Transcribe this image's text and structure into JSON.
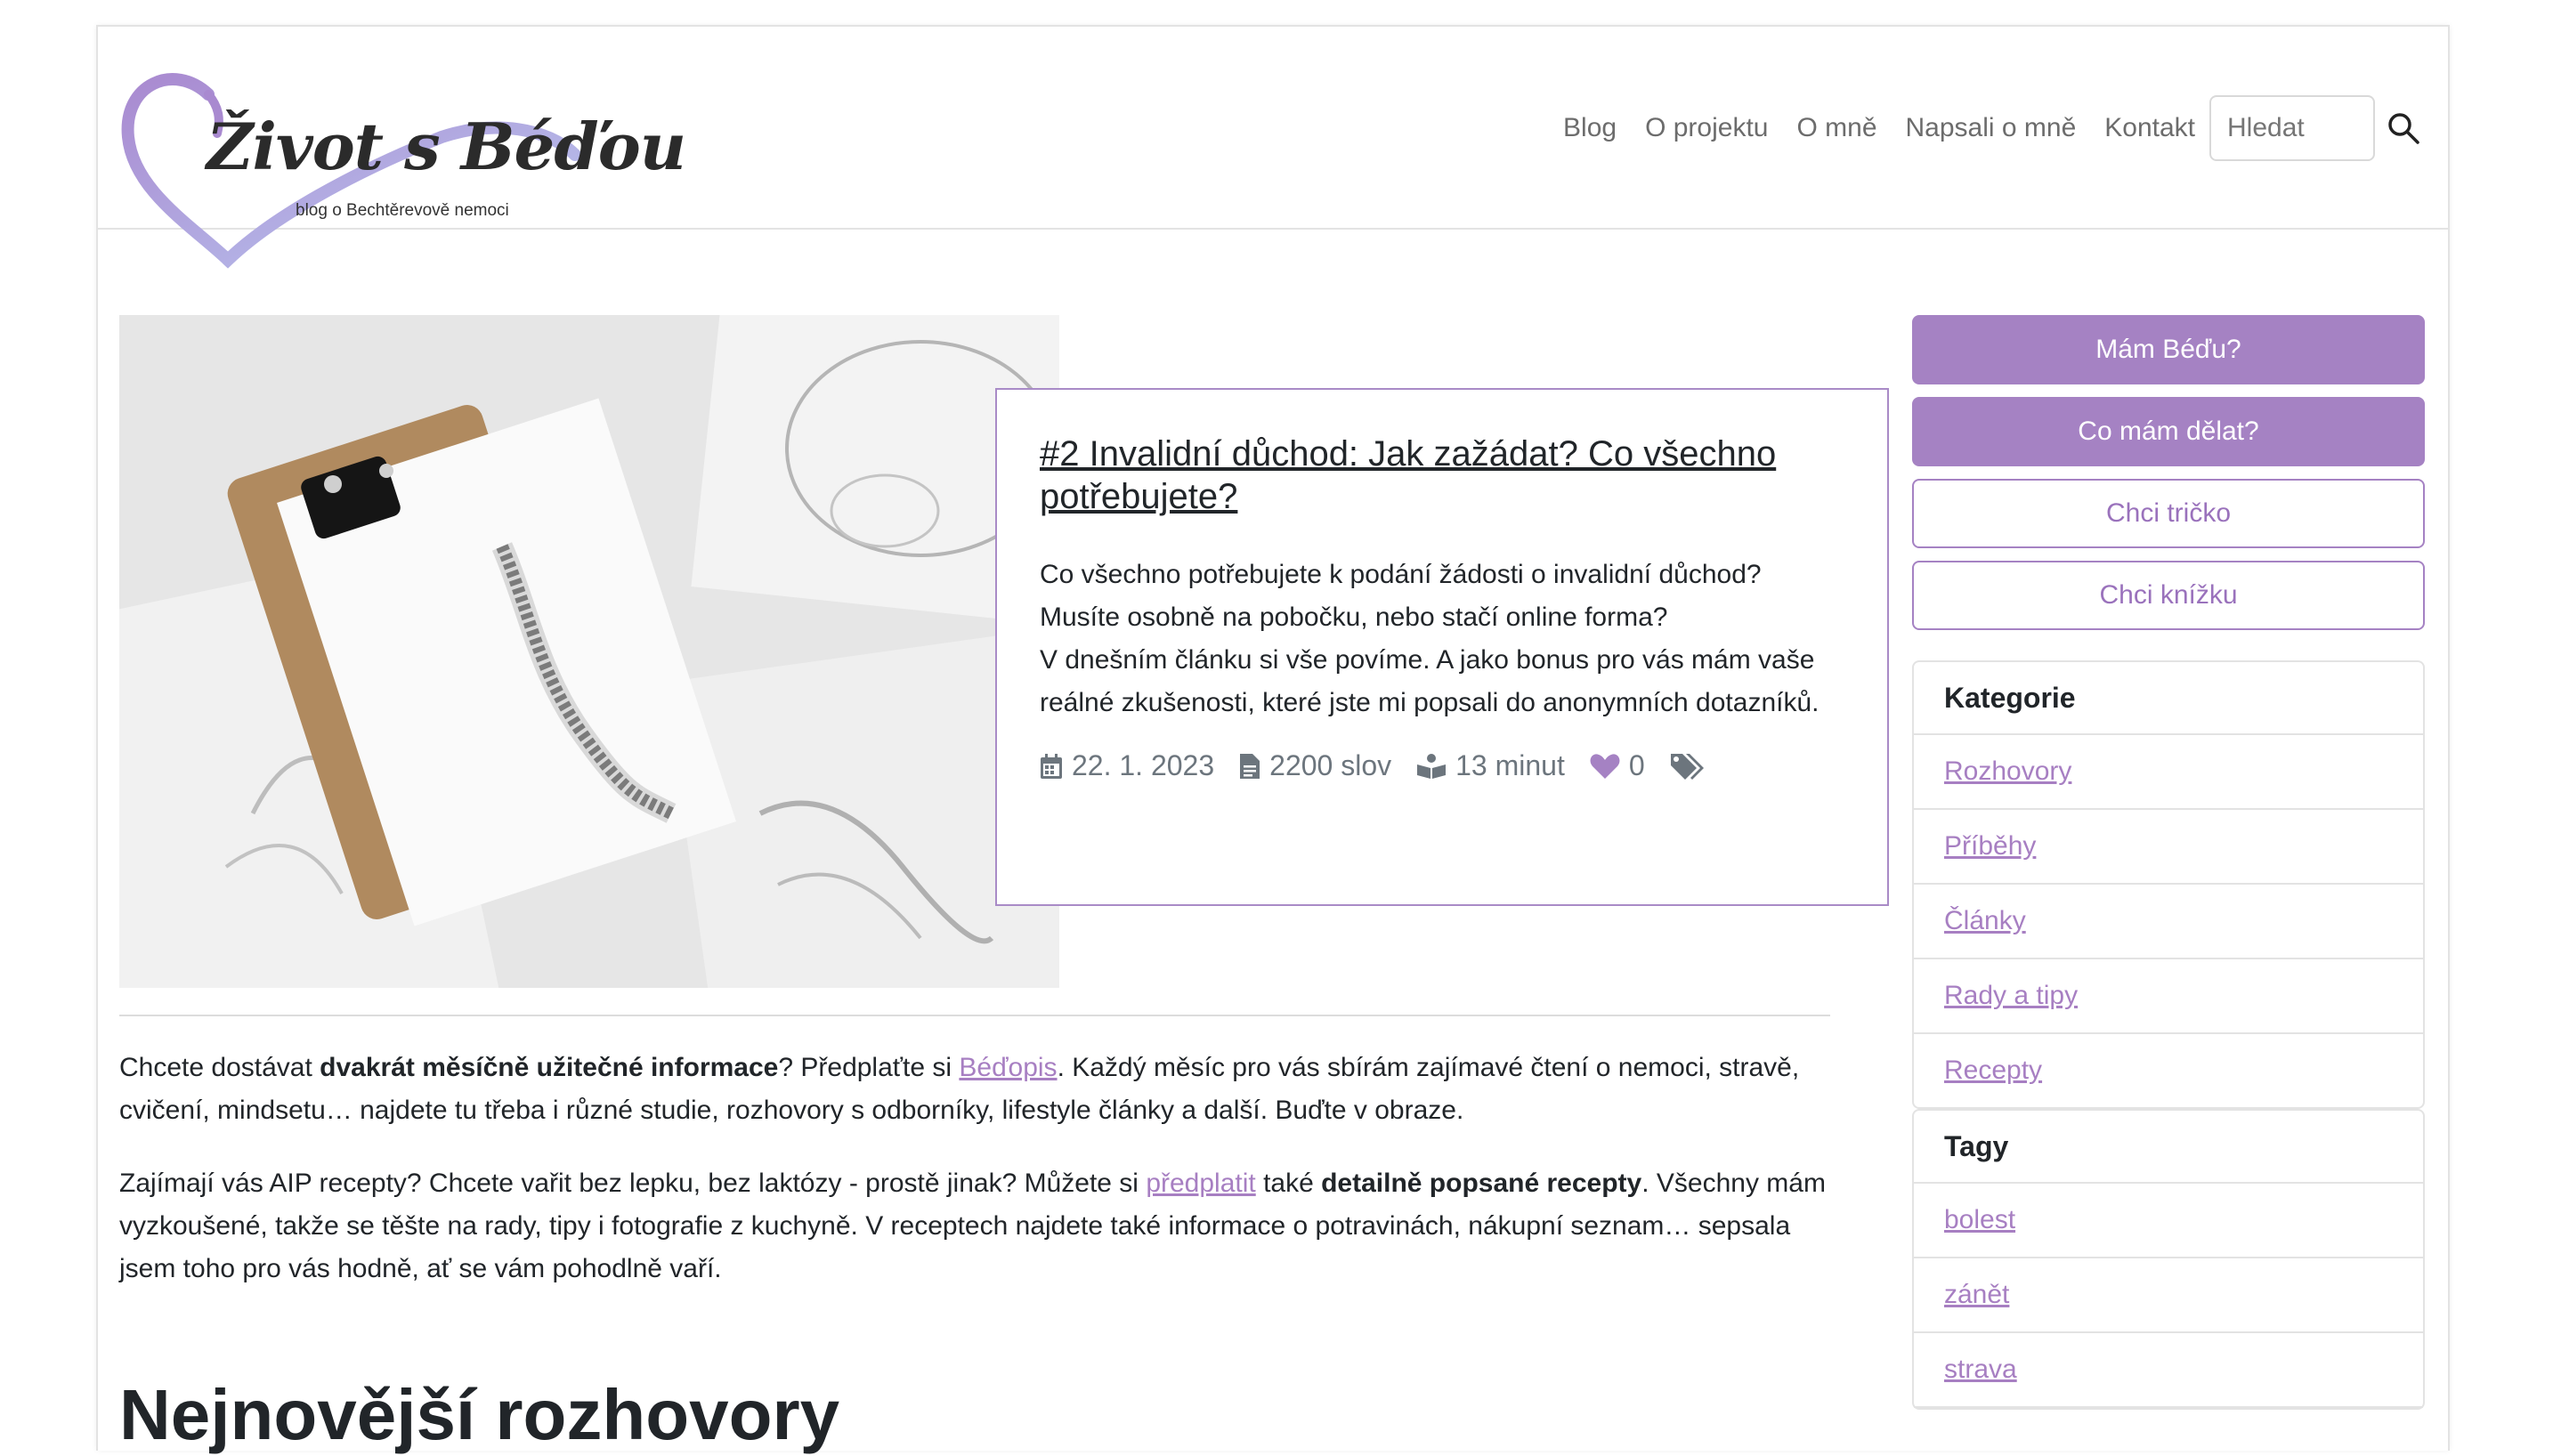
{
  "logo": {
    "title": "Život s Béďou",
    "subtitle": "blog o Bechtěrevově nemoci"
  },
  "nav": {
    "items": [
      "Blog",
      "O projektu",
      "O mně",
      "Napsali o mně",
      "Kontakt"
    ],
    "search_placeholder": "Hledat"
  },
  "featured": {
    "title": "#2 Invalidní důchod: Jak zažádat? Co všechno potřebujete?",
    "excerpt_1": "Co všechno potřebujete k podání žádosti o invalidní důchod? Musíte osobně na pobočku, nebo stačí online forma?",
    "excerpt_2": "V dnešním článku si vše povíme. A jako bonus pro vás mám vaše reálné zkušenosti, které jste mi popsali do anonymních dotazníků.",
    "date": "22. 1. 2023",
    "words": "2200 slov",
    "read_time": "13 minut",
    "likes": "0"
  },
  "newsletter": {
    "p1_a": "Chcete dostávat ",
    "p1_b": "dvakrát měsíčně užitečné informace",
    "p1_c": "? Předplaťte si ",
    "p1_link": "Béďopis",
    "p1_d": ". Každý měsíc pro vás sbírám zajímavé čtení o nemoci, stravě, cvičení, mindsetu… najdete tu třeba i různé studie, rozhovory s odborníky, lifestyle články a další. Buďte v obraze.",
    "p2_a": "Zajímají vás AIP recepty? Chcete vařit bez lepku, bez laktózy - prostě jinak? Můžete si ",
    "p2_link": "předplatit",
    "p2_b": " také ",
    "p2_c": "detailně popsané recepty",
    "p2_d": ". Všechny mám vyzkoušené, takže se těšte na rady, tipy i fotografie z kuchyně. V receptech najdete také informace o potravinách, nákupní seznam… sepsala jsem toho pro vás hodně, ať se vám pohodlně vaří."
  },
  "section_heading": "Nejnovější rozhovory",
  "sidebar": {
    "buttons": [
      "Mám Béďu?",
      "Co mám dělat?",
      "Chci tričko",
      "Chci knížku"
    ],
    "categories_title": "Kategorie",
    "categories": [
      "Rozhovory",
      "Příběhy",
      "Články",
      "Rady a tipy",
      "Recepty"
    ],
    "tags_title": "Tagy",
    "tags": [
      "bolest",
      "zánět",
      "strava"
    ]
  },
  "colors": {
    "accent": "#a582c3",
    "link": "#a77fc2",
    "nav": "#6c6c6c"
  }
}
